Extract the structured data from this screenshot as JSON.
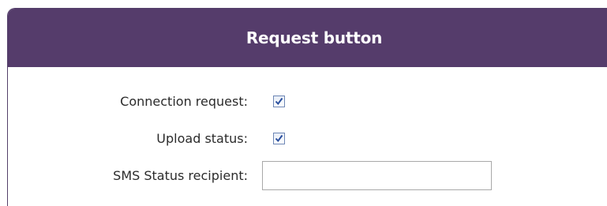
{
  "panel": {
    "title": "Request button"
  },
  "fields": {
    "connection_request": {
      "label": "Connection request:",
      "checked": true
    },
    "upload_status": {
      "label": "Upload status:",
      "checked": true
    },
    "sms_status_recipient": {
      "label": "SMS Status recipient:",
      "value": "",
      "placeholder": ""
    }
  },
  "colors": {
    "header_bg": "#553c6b",
    "header_text": "#ffffff",
    "checkbox_border": "#6e87b5",
    "checkmark": "#2a4f9e"
  },
  "icons": {
    "checkmark": "check-icon"
  }
}
